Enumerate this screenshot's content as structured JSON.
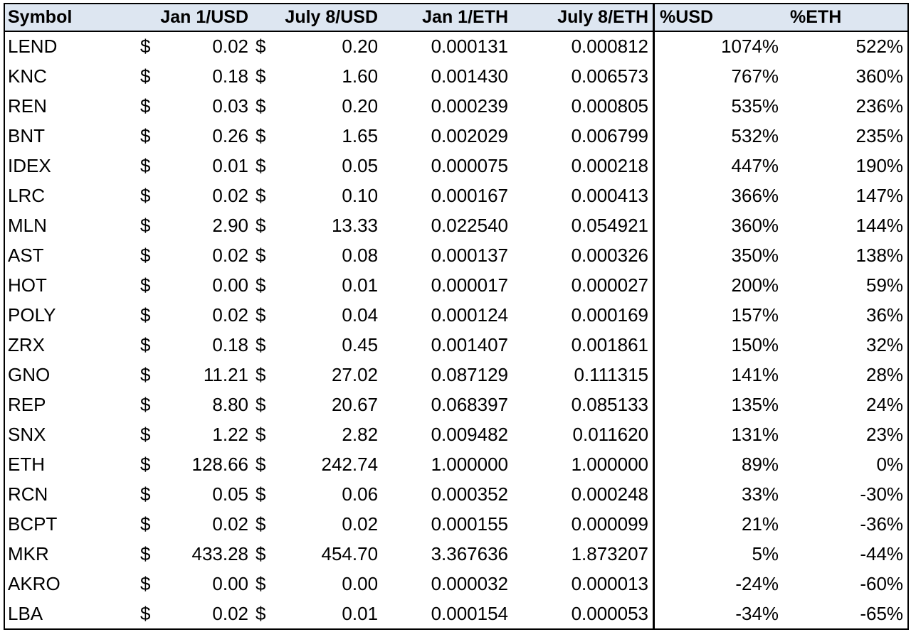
{
  "table": {
    "headers": {
      "symbol": "Symbol",
      "jan1_usd": "Jan 1/USD",
      "jul8_usd": "July 8/USD",
      "jan1_eth": "Jan 1/ETH",
      "jul8_eth": "July 8/ETH",
      "pct_usd": "%USD",
      "pct_eth": "%ETH"
    },
    "currency_symbol": "$",
    "rows": [
      {
        "symbol": "LEND",
        "jan1_usd": "0.02",
        "jul8_usd": "0.20",
        "jan1_eth": "0.000131",
        "jul8_eth": "0.000812",
        "pct_usd": "1074%",
        "pct_eth": "522%"
      },
      {
        "symbol": "KNC",
        "jan1_usd": "0.18",
        "jul8_usd": "1.60",
        "jan1_eth": "0.001430",
        "jul8_eth": "0.006573",
        "pct_usd": "767%",
        "pct_eth": "360%"
      },
      {
        "symbol": "REN",
        "jan1_usd": "0.03",
        "jul8_usd": "0.20",
        "jan1_eth": "0.000239",
        "jul8_eth": "0.000805",
        "pct_usd": "535%",
        "pct_eth": "236%"
      },
      {
        "symbol": "BNT",
        "jan1_usd": "0.26",
        "jul8_usd": "1.65",
        "jan1_eth": "0.002029",
        "jul8_eth": "0.006799",
        "pct_usd": "532%",
        "pct_eth": "235%"
      },
      {
        "symbol": "IDEX",
        "jan1_usd": "0.01",
        "jul8_usd": "0.05",
        "jan1_eth": "0.000075",
        "jul8_eth": "0.000218",
        "pct_usd": "447%",
        "pct_eth": "190%"
      },
      {
        "symbol": "LRC",
        "jan1_usd": "0.02",
        "jul8_usd": "0.10",
        "jan1_eth": "0.000167",
        "jul8_eth": "0.000413",
        "pct_usd": "366%",
        "pct_eth": "147%"
      },
      {
        "symbol": "MLN",
        "jan1_usd": "2.90",
        "jul8_usd": "13.33",
        "jan1_eth": "0.022540",
        "jul8_eth": "0.054921",
        "pct_usd": "360%",
        "pct_eth": "144%"
      },
      {
        "symbol": "AST",
        "jan1_usd": "0.02",
        "jul8_usd": "0.08",
        "jan1_eth": "0.000137",
        "jul8_eth": "0.000326",
        "pct_usd": "350%",
        "pct_eth": "138%"
      },
      {
        "symbol": "HOT",
        "jan1_usd": "0.00",
        "jul8_usd": "0.01",
        "jan1_eth": "0.000017",
        "jul8_eth": "0.000027",
        "pct_usd": "200%",
        "pct_eth": "59%"
      },
      {
        "symbol": "POLY",
        "jan1_usd": "0.02",
        "jul8_usd": "0.04",
        "jan1_eth": "0.000124",
        "jul8_eth": "0.000169",
        "pct_usd": "157%",
        "pct_eth": "36%"
      },
      {
        "symbol": "ZRX",
        "jan1_usd": "0.18",
        "jul8_usd": "0.45",
        "jan1_eth": "0.001407",
        "jul8_eth": "0.001861",
        "pct_usd": "150%",
        "pct_eth": "32%"
      },
      {
        "symbol": "GNO",
        "jan1_usd": "11.21",
        "jul8_usd": "27.02",
        "jan1_eth": "0.087129",
        "jul8_eth": "0.111315",
        "pct_usd": "141%",
        "pct_eth": "28%"
      },
      {
        "symbol": "REP",
        "jan1_usd": "8.80",
        "jul8_usd": "20.67",
        "jan1_eth": "0.068397",
        "jul8_eth": "0.085133",
        "pct_usd": "135%",
        "pct_eth": "24%"
      },
      {
        "symbol": "SNX",
        "jan1_usd": "1.22",
        "jul8_usd": "2.82",
        "jan1_eth": "0.009482",
        "jul8_eth": "0.011620",
        "pct_usd": "131%",
        "pct_eth": "23%"
      },
      {
        "symbol": "ETH",
        "jan1_usd": "128.66",
        "jul8_usd": "242.74",
        "jan1_eth": "1.000000",
        "jul8_eth": "1.000000",
        "pct_usd": "89%",
        "pct_eth": "0%"
      },
      {
        "symbol": "RCN",
        "jan1_usd": "0.05",
        "jul8_usd": "0.06",
        "jan1_eth": "0.000352",
        "jul8_eth": "0.000248",
        "pct_usd": "33%",
        "pct_eth": "-30%"
      },
      {
        "symbol": "BCPT",
        "jan1_usd": "0.02",
        "jul8_usd": "0.02",
        "jan1_eth": "0.000155",
        "jul8_eth": "0.000099",
        "pct_usd": "21%",
        "pct_eth": "-36%"
      },
      {
        "symbol": "MKR",
        "jan1_usd": "433.28",
        "jul8_usd": "454.70",
        "jan1_eth": "3.367636",
        "jul8_eth": "1.873207",
        "pct_usd": "5%",
        "pct_eth": "-44%"
      },
      {
        "symbol": "AKRO",
        "jan1_usd": "0.00",
        "jul8_usd": "0.00",
        "jan1_eth": "0.000032",
        "jul8_eth": "0.000013",
        "pct_usd": "-24%",
        "pct_eth": "-60%"
      },
      {
        "symbol": "LBA",
        "jan1_usd": "0.02",
        "jul8_usd": "0.01",
        "jan1_eth": "0.000154",
        "jul8_eth": "0.000053",
        "pct_usd": "-34%",
        "pct_eth": "-65%"
      }
    ]
  }
}
